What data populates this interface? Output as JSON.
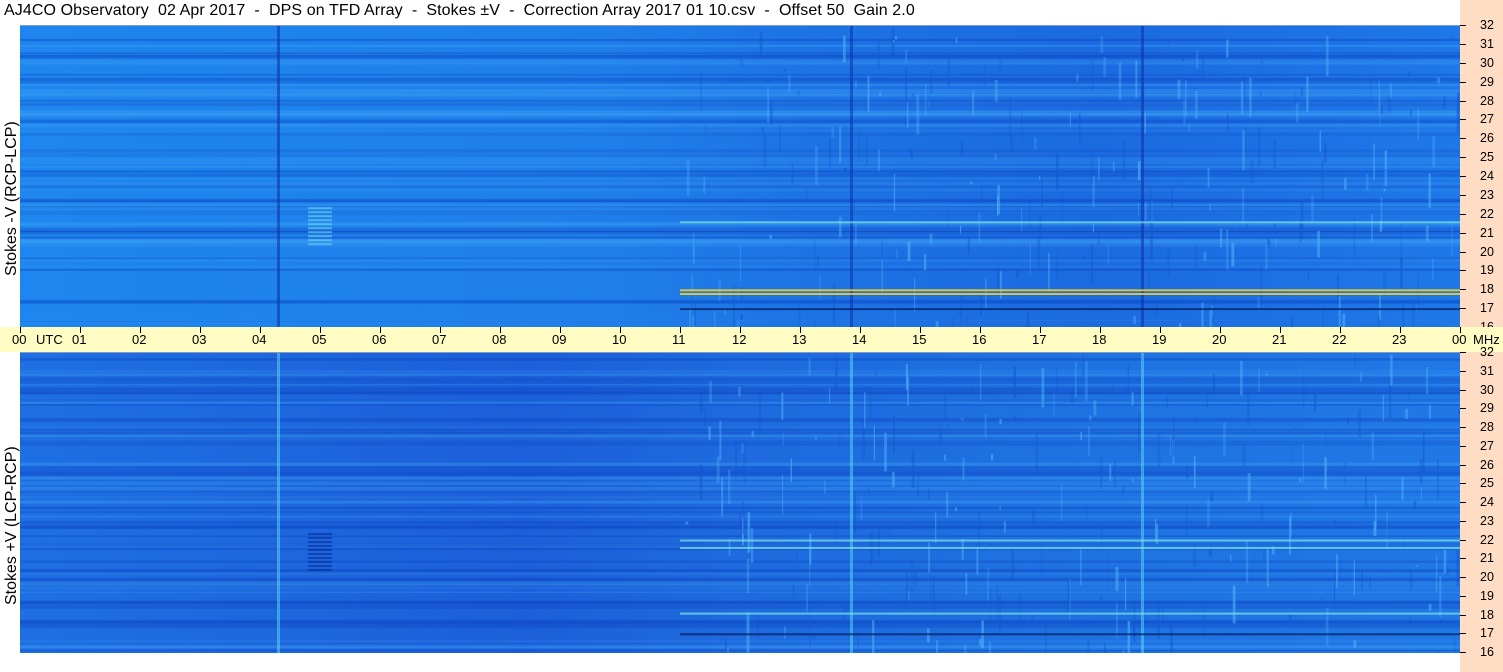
{
  "title": "AJ4CO Observatory  02 Apr 2017  -  DPS on TFD Array  -  Stokes ±V  -  Correction Array 2017 01 10.csv  -  Offset 50  Gain 2.0",
  "colors": {
    "background_low": "#1f6fe8",
    "background_mid": "#1e88f0",
    "dark_band": "#0a3fbf",
    "bright_band": "#7fe8e0",
    "hot": "#ffd21a",
    "time_axis_bg": "#fffdc4",
    "freq_axis_bg": "#ffdcc4"
  },
  "chart_data": [
    {
      "type": "heatmap",
      "title": "",
      "ylabel": "Stokes -V (RCP-LCP)",
      "xlabel": "UTC",
      "y_unit": "MHz",
      "x_ticks": [
        "00",
        "01",
        "02",
        "03",
        "04",
        "05",
        "06",
        "07",
        "08",
        "09",
        "10",
        "11",
        "12",
        "13",
        "14",
        "15",
        "16",
        "17",
        "18",
        "19",
        "20",
        "21",
        "22",
        "23",
        "00"
      ],
      "y_ticks": [
        32,
        31,
        30,
        29,
        28,
        27,
        26,
        25,
        24,
        23,
        22,
        21,
        20,
        19,
        18,
        17,
        16
      ],
      "xlim": [
        0,
        24
      ],
      "ylim": [
        16,
        32
      ],
      "features": {
        "vertical_lines_utc": [
          4.3,
          13.85,
          18.7
        ],
        "brightening_after_utc": 11.0,
        "horizontal_bands_mhz": [
          17.0,
          17.8,
          18.0,
          21.6
        ]
      }
    },
    {
      "type": "heatmap",
      "title": "",
      "ylabel": "Stokes +V (LCP-RCP)",
      "xlabel": "UTC",
      "y_unit": "MHz",
      "x_ticks": [
        "00",
        "01",
        "02",
        "03",
        "04",
        "05",
        "06",
        "07",
        "08",
        "09",
        "10",
        "11",
        "12",
        "13",
        "14",
        "15",
        "16",
        "17",
        "18",
        "19",
        "20",
        "21",
        "22",
        "23",
        "00"
      ],
      "y_ticks": [
        32,
        31,
        30,
        29,
        28,
        27,
        26,
        25,
        24,
        23,
        22,
        21,
        20,
        19,
        18,
        17,
        16
      ],
      "xlim": [
        0,
        24
      ],
      "ylim": [
        16,
        32
      ],
      "features": {
        "vertical_lines_utc": [
          4.3,
          13.85,
          18.7
        ],
        "brightening_after_utc": 11.0,
        "horizontal_bands_mhz": [
          17.0,
          18.1,
          21.6,
          22.0
        ]
      }
    }
  ],
  "axis": {
    "utc_label": "UTC",
    "mhz_label": "MHz",
    "time_labels": [
      "00",
      "01",
      "02",
      "03",
      "04",
      "05",
      "06",
      "07",
      "08",
      "09",
      "10",
      "11",
      "12",
      "13",
      "14",
      "15",
      "16",
      "17",
      "18",
      "19",
      "20",
      "21",
      "22",
      "23",
      "00"
    ]
  }
}
